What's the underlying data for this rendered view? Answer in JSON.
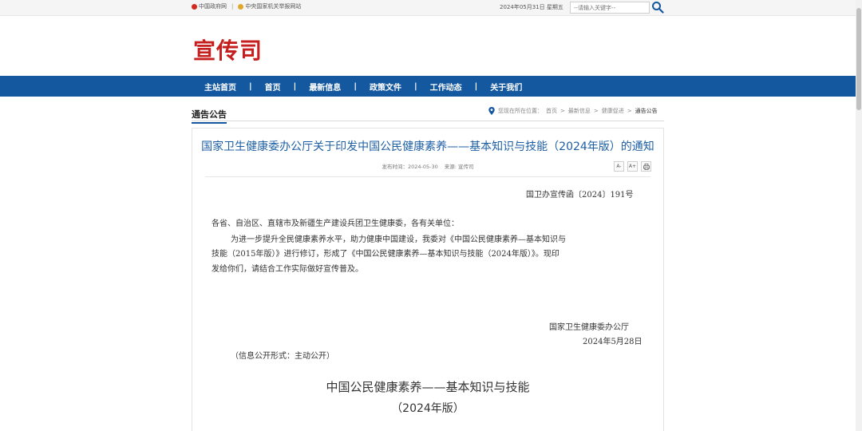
{
  "topbar": {
    "link1": "中国政府网",
    "separator": "|",
    "link2": "中央国家机关举报网站",
    "date": "2024年05月31日 星期五",
    "search_placeholder": "--请输入关键字--"
  },
  "header": {
    "logo": "宣传司"
  },
  "nav": {
    "items": [
      "主站首页",
      "首页",
      "最新信息",
      "政策文件",
      "工作动态",
      "关于我们"
    ],
    "separator": "|"
  },
  "section": {
    "title": "通告公告",
    "breadcrumb": {
      "prefix": "您现在所在位置：",
      "items": [
        "首页",
        "最新信息",
        "健康促进",
        "通告公告"
      ],
      "separator": ">"
    }
  },
  "article": {
    "title": "国家卫生健康委办公厅关于印发中国公民健康素养——基本知识与技能（2024年版）的通知",
    "meta_date": "发布时间：2024-05-30",
    "meta_source": "来源: 宣传司",
    "tools": [
      "A-",
      "A+",
      "⎙"
    ],
    "doc_number": "国卫办宣传函〔2024〕191号",
    "salutation": "各省、自治区、直辖市及新疆生产建设兵团卫生健康委，各有关单位：",
    "para_line1": "为进一步提升全民健康素养水平，助力健康中国建设，我委对《中国公民健康素养—基本知识与",
    "para_line2": "技能（2015年版）》进行修订，形成了《中国公民健康素养—基本知识与技能（2024年版）》。现印",
    "para_line3": "发给你们，请结合工作实际做好宣传普及。",
    "signature_org": "国家卫生健康委办公厅",
    "signature_date": "2024年5月28日",
    "publication_form": "（信息公开形式：主动公开）",
    "subtitle": "中国公民健康素养——基本知识与技能",
    "subtitle_version": "（2024年版）"
  },
  "colors": {
    "nav_bg": "#1458a0",
    "logo": "#c51f1f",
    "title": "#1d5fa5"
  }
}
